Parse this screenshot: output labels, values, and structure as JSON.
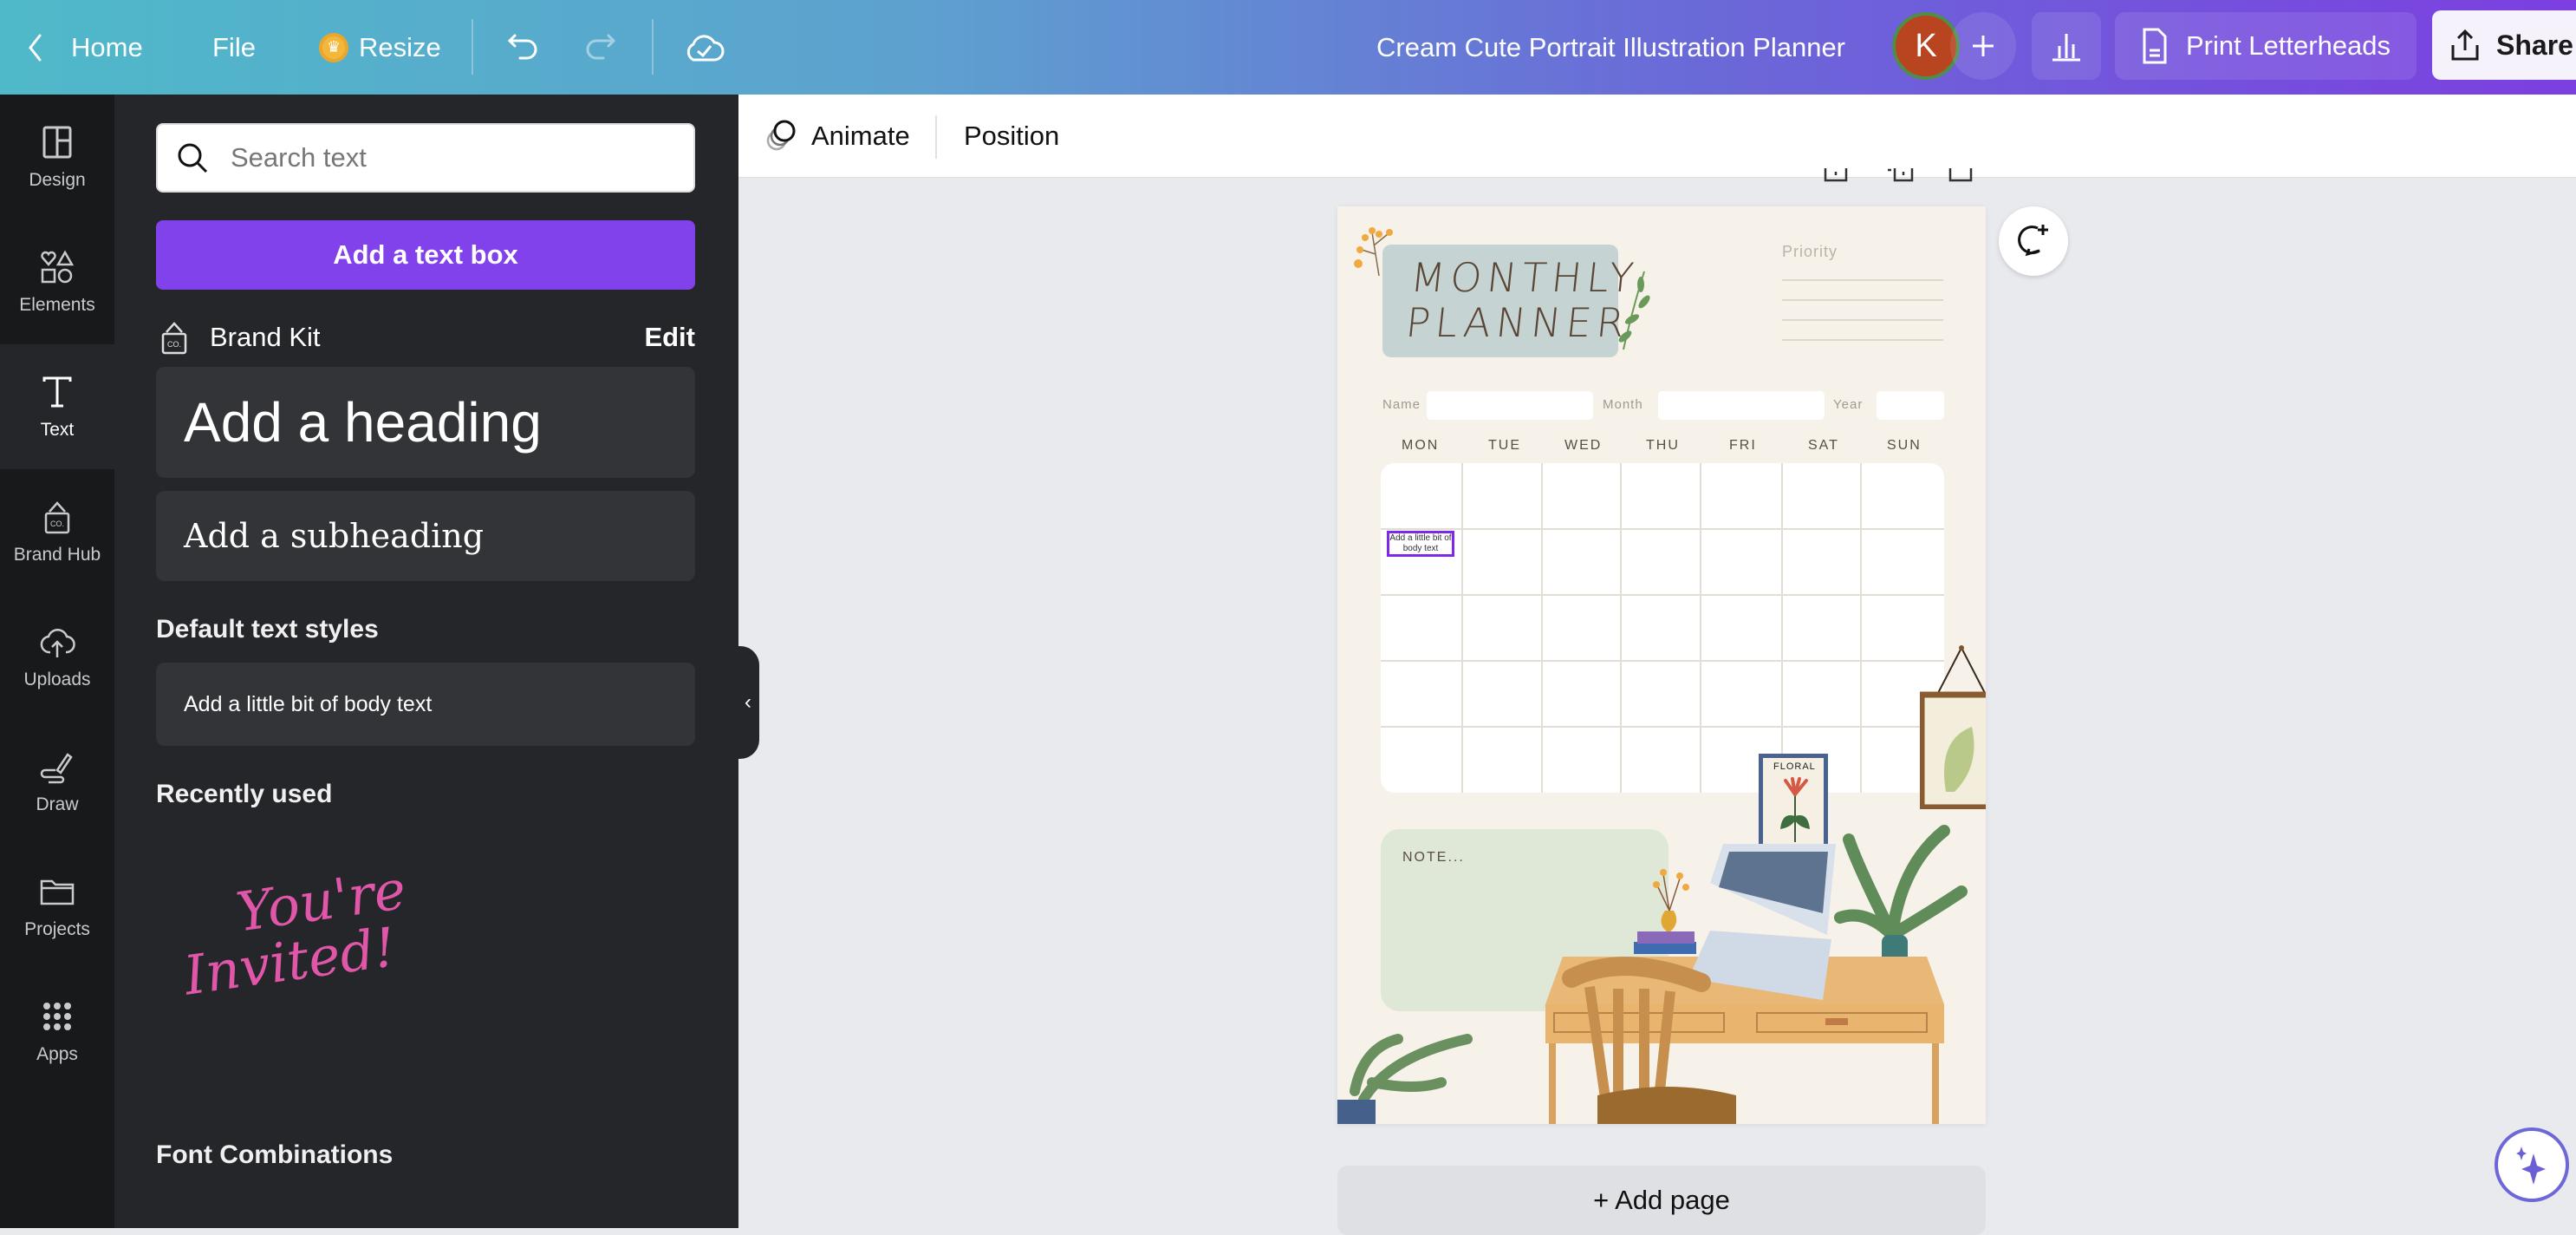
{
  "topbar": {
    "home_label": "Home",
    "file_label": "File",
    "resize_label": "Resize",
    "doc_title": "Cream Cute Portrait Illustration Planner",
    "avatar_initial": "K",
    "print_label": "Print Letterheads",
    "share_label": "Share",
    "avatar_color": "#b84520"
  },
  "rail": {
    "items": [
      {
        "label": "Design",
        "icon": "layout-icon"
      },
      {
        "label": "Elements",
        "icon": "shapes-icon"
      },
      {
        "label": "Text",
        "icon": "text-icon",
        "active": true
      },
      {
        "label": "Brand Hub",
        "icon": "brand-icon"
      },
      {
        "label": "Uploads",
        "icon": "cloud-upload-icon"
      },
      {
        "label": "Draw",
        "icon": "pen-icon"
      },
      {
        "label": "Projects",
        "icon": "folder-icon"
      },
      {
        "label": "Apps",
        "icon": "grid-icon"
      }
    ]
  },
  "panel": {
    "search_placeholder": "Search text",
    "add_text_box": "Add a text box",
    "brand_kit": "Brand Kit",
    "edit": "Edit",
    "add_heading": "Add a heading",
    "add_subheading": "Add a subheading",
    "default_styles_title": "Default text styles",
    "add_body": "Add a little bit of body text",
    "recently_used_title": "Recently used",
    "recent_item_line1": "You're",
    "recent_item_line2": "Invited!",
    "font_combinations_title": "Font Combinations",
    "accent_color": "#8142ec"
  },
  "context": {
    "animate": "Animate",
    "position": "Position"
  },
  "design": {
    "title_line1": "MONTHLY",
    "title_line2": "PLANNER",
    "priority": "Priority",
    "name_label": "Name",
    "month_label": "Month",
    "year_label": "Year",
    "days": [
      "MON",
      "TUE",
      "WED",
      "THU",
      "FRI",
      "SAT",
      "SUN"
    ],
    "selected_text": "Add a little bit of body text",
    "note_label": "NOTE...",
    "floral_label": "FLORAL"
  },
  "canvas": {
    "add_page": "+ Add page"
  }
}
